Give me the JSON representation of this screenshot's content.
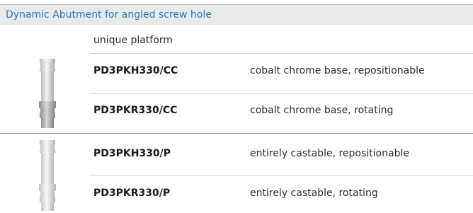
{
  "header": {
    "title": "Dynamic Abutment for angled screw hole"
  },
  "platform_label": "unique platform",
  "groups": [
    {
      "image": "cobalt-chrome-abutment-image",
      "rows": [
        {
          "code": "PD3PKH330/CC",
          "description": "cobalt chrome base, repositionable"
        },
        {
          "code": "PD3PKR330/CC",
          "description": "cobalt chrome base, rotating"
        }
      ]
    },
    {
      "image": "castable-abutment-image",
      "rows": [
        {
          "code": "PD3PKH330/P",
          "description": "entirely castable, repositionable"
        },
        {
          "code": "PD3PKR330/P",
          "description": "entirely castable, rotating"
        }
      ]
    }
  ],
  "colors": {
    "title_text": "#2a7bbf",
    "title_bg": "#e8eaea"
  }
}
